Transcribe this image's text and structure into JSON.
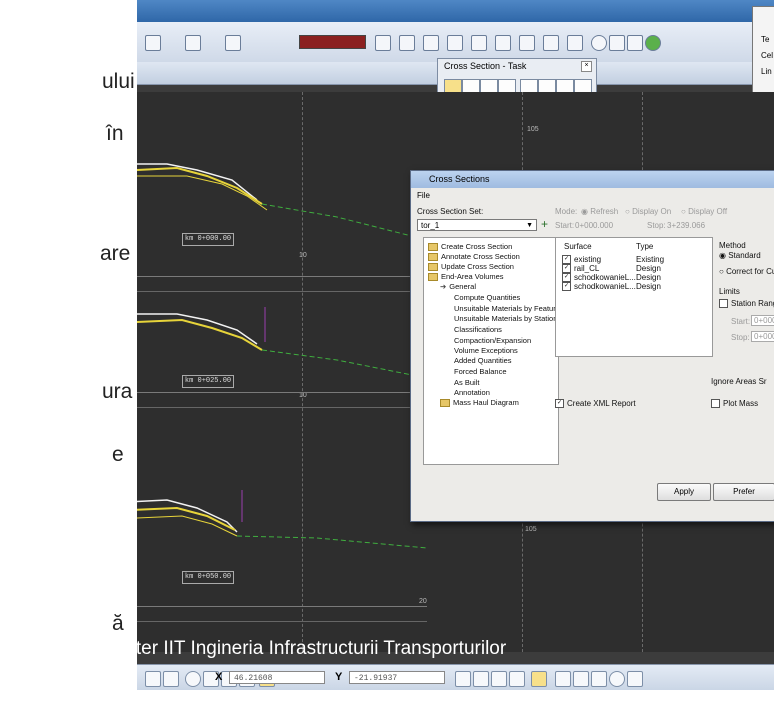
{
  "left_text": {
    "lines": [
      "ului",
      "în",
      "are",
      "ura",
      "e",
      "ă"
    ]
  },
  "cross_section_task": {
    "title": "Cross Section - Task",
    "close": "×"
  },
  "top_right_panel": {
    "labels": [
      "Te",
      "Cel",
      "Lin"
    ]
  },
  "view": {
    "axis_ticks": [
      "105",
      "10",
      "10",
      "20",
      "105"
    ],
    "station_labels": [
      "km 0+000.00",
      "km 0+025.00",
      "km 0+050.00"
    ]
  },
  "dialog": {
    "title": "Cross Sections",
    "menu_file": "File",
    "cross_section_set_label": "Cross Section Set:",
    "cross_section_set_value": "tor_1",
    "mode_label": "Mode:",
    "mode_refresh": "Refresh",
    "mode_display_on": "Display On",
    "mode_display_off": "Display Off",
    "start_label": "Start:",
    "start_value": "0+000.000",
    "stop_label": "Stop:",
    "stop_value": "3+239.066",
    "tree": [
      {
        "label": "Create Cross Section",
        "level": 0,
        "folder": true
      },
      {
        "label": "Annotate Cross Section",
        "level": 0,
        "folder": true
      },
      {
        "label": "Update Cross Section",
        "level": 0,
        "folder": true
      },
      {
        "label": "End-Area Volumes",
        "level": 0,
        "folder": true
      },
      {
        "label": "General",
        "level": 1,
        "folder": false
      },
      {
        "label": "Compute Quantities",
        "level": 2,
        "folder": false
      },
      {
        "label": "Unsuitable Materials by Feature",
        "level": 2,
        "folder": false
      },
      {
        "label": "Unsuitable Materials by Station",
        "level": 2,
        "folder": false
      },
      {
        "label": "Classifications",
        "level": 2,
        "folder": false
      },
      {
        "label": "Compaction/Expansion",
        "level": 2,
        "folder": false
      },
      {
        "label": "Volume Exceptions",
        "level": 2,
        "folder": false
      },
      {
        "label": "Added Quantities",
        "level": 2,
        "folder": false
      },
      {
        "label": "Forced Balance",
        "level": 2,
        "folder": false
      },
      {
        "label": "As Built",
        "level": 2,
        "folder": false
      },
      {
        "label": "Annotation",
        "level": 2,
        "folder": false
      },
      {
        "label": "Mass Haul Diagram",
        "level": 1,
        "folder": true
      }
    ],
    "surface_header": "Surface",
    "type_header": "Type",
    "surfaces": [
      {
        "name": "existing",
        "type": "Existing"
      },
      {
        "name": "rail_CL",
        "type": "Design"
      },
      {
        "name": "schodkowanieL...",
        "type": "Design"
      },
      {
        "name": "schodkowanieL...",
        "type": "Design"
      }
    ],
    "method_label": "Method",
    "method_standard": "Standard",
    "method_correct": "Correct for Cur",
    "limits_label": "Limits",
    "station_range": "Station Range",
    "limit_start_label": "Start:",
    "limit_start_value": "0+000",
    "limit_stop_label": "Stop:",
    "limit_stop_value": "0+000",
    "ignore_areas": "Ignore Areas Sr",
    "plot_mass": "Plot Mass",
    "create_xml": "Create XML Report",
    "apply_button": "Apply",
    "prefs_button": "Prefer"
  },
  "status": {
    "x_label": "X",
    "x_value": "46.21608",
    "y_label": "Y",
    "y_value": "-21.91937"
  },
  "caption": "Master IIT Ingineria Infrastructurii Transporturilor",
  "colors": {
    "title_blue": "#2f67a8",
    "view_bg": "#2e2e2e",
    "yellow": "#e7d43a",
    "white_line": "#f2f2f2",
    "green_dash": "#3fae3f"
  }
}
